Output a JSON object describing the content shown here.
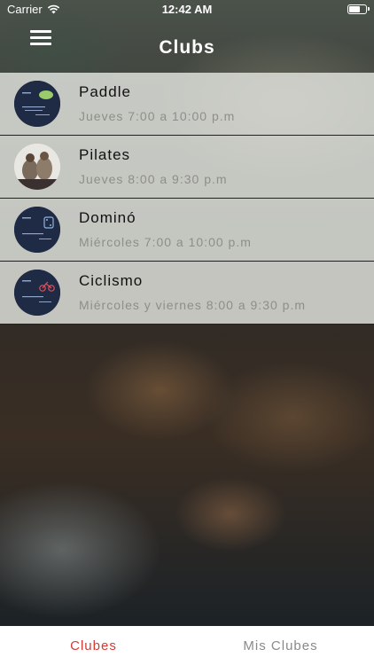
{
  "status_bar": {
    "carrier": "Carrier",
    "time": "12:42 AM",
    "battery_level": 0.7
  },
  "nav": {
    "title": "Clubs",
    "menu_icon": "hamburger-menu-icon"
  },
  "clubs": [
    {
      "name": "Paddle",
      "schedule": "Jueves 7:00 a 10:00 p.m"
    },
    {
      "name": "Pilates",
      "schedule": "Jueves 8:00 a 9:30 p.m"
    },
    {
      "name": "Dominó",
      "schedule": "Miércoles 7:00 a 10:00 p.m"
    },
    {
      "name": "Ciclismo",
      "schedule": "Miércoles y viernes 8:00 a 9:30 p.m"
    }
  ],
  "tabs": [
    {
      "label": "Clubes",
      "active": true
    },
    {
      "label": "Mis Clubes",
      "active": false
    }
  ],
  "colors": {
    "accent": "#d23b35",
    "row_bg": "#dedfda",
    "tabbar_bg": "#ffffff"
  }
}
